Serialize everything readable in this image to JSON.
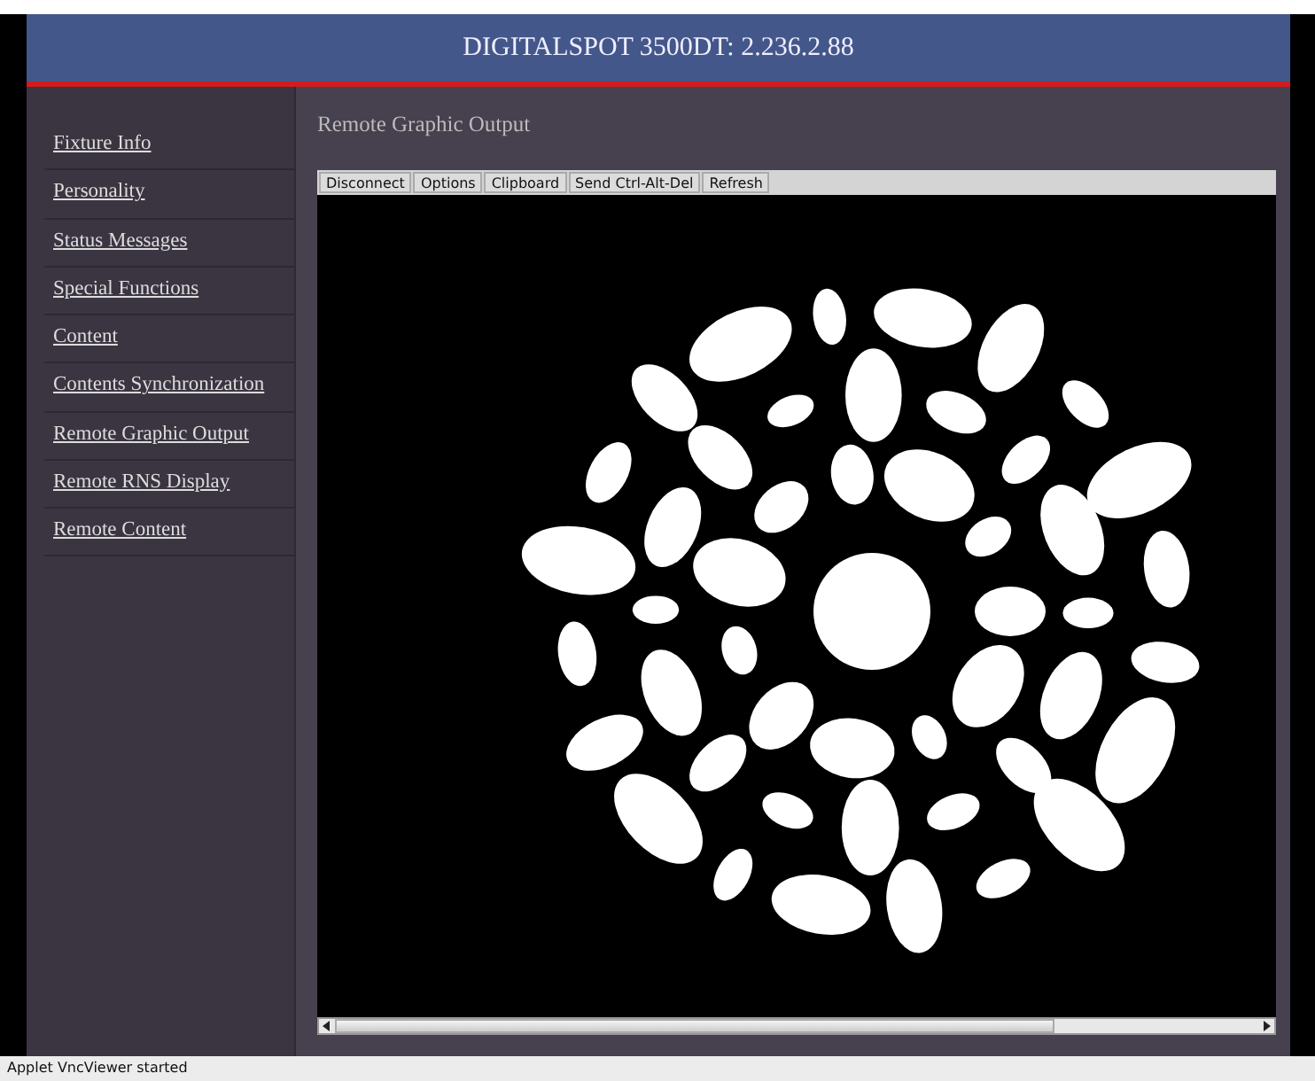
{
  "header": {
    "title": "DIGITALSPOT 3500DT: 2.236.2.88"
  },
  "sidebar": {
    "items": [
      {
        "label": "Fixture Info"
      },
      {
        "label": "Personality"
      },
      {
        "label": "Status Messages"
      },
      {
        "label": "Special Functions"
      },
      {
        "label": "Content"
      },
      {
        "label": "Contents Synchronization"
      },
      {
        "label": "Remote Graphic Output"
      },
      {
        "label": "Remote RNS Display"
      },
      {
        "label": "Remote Content"
      }
    ]
  },
  "content": {
    "title": "Remote Graphic Output",
    "viewer": {
      "toolbar": [
        "Disconnect",
        "Options",
        "Clipboard",
        "Send Ctrl-Alt-Del",
        "Refresh"
      ]
    }
  },
  "status_bar": "Applet VncViewer started"
}
